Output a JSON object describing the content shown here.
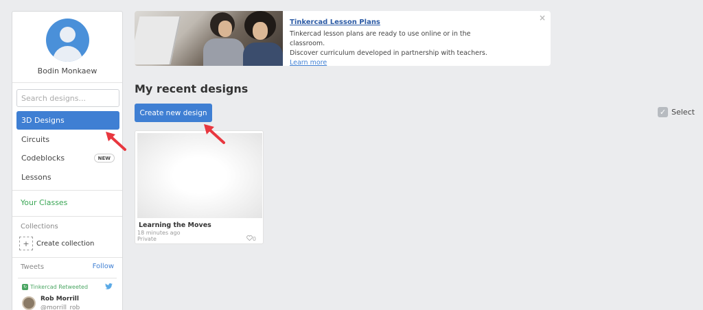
{
  "sidebar": {
    "username": "Bodin Monkaew",
    "search_placeholder": "Search designs...",
    "nav": [
      {
        "label": "3D Designs"
      },
      {
        "label": "Circuits"
      },
      {
        "label": "Codeblocks",
        "badge": "NEW"
      },
      {
        "label": "Lessons"
      }
    ],
    "your_classes": "Your Classes",
    "collections_title": "Collections",
    "create_collection": "Create collection",
    "create_collection_icon": "+",
    "tweets_title": "Tweets",
    "follow_label": "Follow",
    "tweet": {
      "retweet_text": "Tinkercad Retweeted",
      "name": "Rob Morrill",
      "handle": "@morrill_rob"
    }
  },
  "banner": {
    "title": "Tinkercad Lesson Plans",
    "text_line1": "Tinkercad lesson plans are ready to use online or in the classroom.",
    "text_line2": "Discover curriculum developed in partnership with teachers.",
    "link_text": "Learn more",
    "close": "×"
  },
  "main": {
    "heading": "My recent designs",
    "create_button": "Create new design",
    "select_label": "Select",
    "select_check": "✓"
  },
  "designs": [
    {
      "title": "Learning the Moves",
      "time": "18 minutes ago",
      "privacy": "Private",
      "likes": "0"
    }
  ],
  "colors": {
    "accent": "#3f7fd3",
    "classes_green": "#3aa655",
    "annotation_red": "#e8373f"
  }
}
